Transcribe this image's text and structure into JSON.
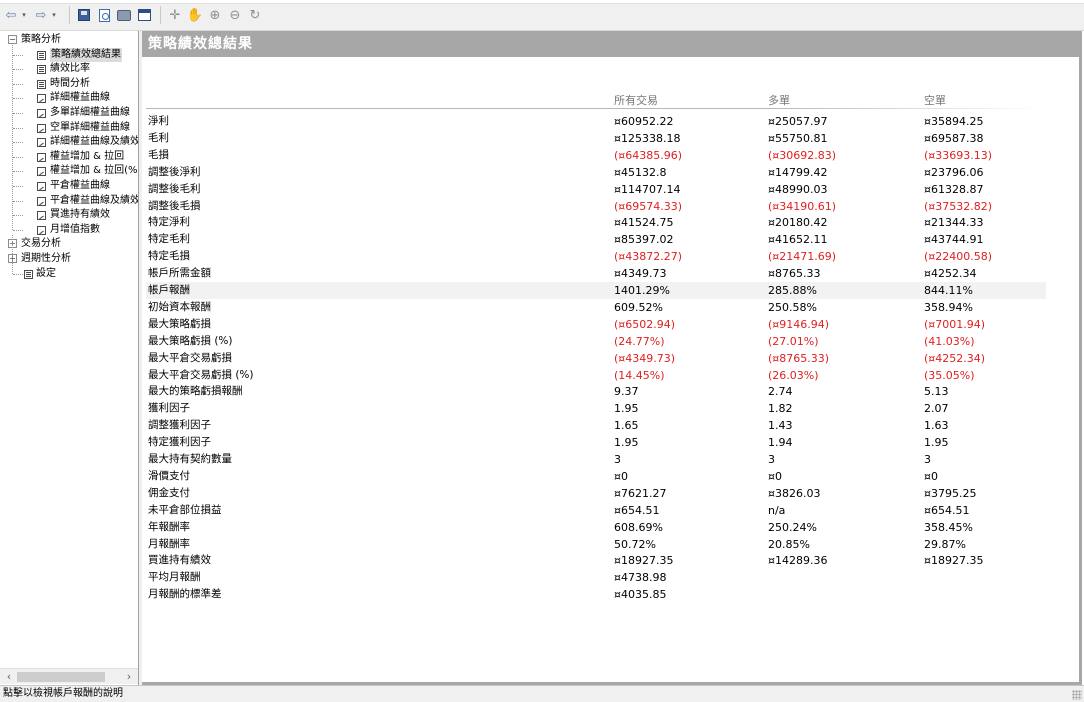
{
  "tree": {
    "root_label": "策略分析",
    "children": [
      {
        "label": "策略績效總結果",
        "icon": "table-icon",
        "selected": true
      },
      {
        "label": "績效比率",
        "icon": "table-icon"
      },
      {
        "label": "時間分析",
        "icon": "table-icon"
      },
      {
        "label": "詳細權益曲線",
        "icon": "chart-icon"
      },
      {
        "label": "多單詳細權益曲線",
        "icon": "chart-icon"
      },
      {
        "label": "空單詳細權益曲線",
        "icon": "chart-icon"
      },
      {
        "label": "詳細權益曲線及績效",
        "icon": "chart-icon"
      },
      {
        "label": "權益增加 & 拉回",
        "icon": "chart-icon"
      },
      {
        "label": "權益增加 & 拉回(%)",
        "icon": "chart-icon"
      },
      {
        "label": "平倉權益曲線",
        "icon": "chart-icon"
      },
      {
        "label": "平倉權益曲線及績效",
        "icon": "chart-icon"
      },
      {
        "label": "買進持有績效",
        "icon": "chart-icon"
      },
      {
        "label": "月增值指數",
        "icon": "chart-icon"
      }
    ],
    "siblings": [
      {
        "label": "交易分析",
        "expander": "+"
      },
      {
        "label": "週期性分析",
        "expander": "+"
      },
      {
        "label": "設定",
        "icon": "table-icon"
      }
    ]
  },
  "main": {
    "title": "策略績效總結果",
    "columns": [
      "所有交易",
      "多單",
      "空單"
    ],
    "rows": [
      {
        "label": "淨利",
        "values": [
          "¤60952.22",
          "¤25057.97",
          "¤35894.25"
        ],
        "negative": [
          false,
          false,
          false
        ]
      },
      {
        "label": "毛利",
        "values": [
          "¤125338.18",
          "¤55750.81",
          "¤69587.38"
        ],
        "negative": [
          false,
          false,
          false
        ]
      },
      {
        "label": "毛損",
        "values": [
          "(¤64385.96)",
          "(¤30692.83)",
          "(¤33693.13)"
        ],
        "negative": [
          true,
          true,
          true
        ]
      },
      {
        "label": "調整後淨利",
        "values": [
          "¤45132.8",
          "¤14799.42",
          "¤23796.06"
        ],
        "negative": [
          false,
          false,
          false
        ]
      },
      {
        "label": "調整後毛利",
        "values": [
          "¤114707.14",
          "¤48990.03",
          "¤61328.87"
        ],
        "negative": [
          false,
          false,
          false
        ]
      },
      {
        "label": "調整後毛損",
        "values": [
          "(¤69574.33)",
          "(¤34190.61)",
          "(¤37532.82)"
        ],
        "negative": [
          true,
          true,
          true
        ]
      },
      {
        "label": "特定淨利",
        "values": [
          "¤41524.75",
          "¤20180.42",
          "¤21344.33"
        ],
        "negative": [
          false,
          false,
          false
        ]
      },
      {
        "label": "特定毛利",
        "values": [
          "¤85397.02",
          "¤41652.11",
          "¤43744.91"
        ],
        "negative": [
          false,
          false,
          false
        ]
      },
      {
        "label": "特定毛損",
        "values": [
          "(¤43872.27)",
          "(¤21471.69)",
          "(¤22400.58)"
        ],
        "negative": [
          true,
          true,
          true
        ]
      },
      {
        "label": "帳戶所需金額",
        "values": [
          "¤4349.73",
          "¤8765.33",
          "¤4252.34"
        ],
        "negative": [
          false,
          false,
          false
        ]
      },
      {
        "label": "帳戶報酬",
        "values": [
          "1401.29%",
          "285.88%",
          "844.11%"
        ],
        "negative": [
          false,
          false,
          false
        ],
        "highlight": true
      },
      {
        "label": "初始資本報酬",
        "values": [
          "609.52%",
          "250.58%",
          "358.94%"
        ],
        "negative": [
          false,
          false,
          false
        ]
      },
      {
        "label": "最大策略虧損",
        "values": [
          "(¤6502.94)",
          "(¤9146.94)",
          "(¤7001.94)"
        ],
        "negative": [
          true,
          true,
          true
        ]
      },
      {
        "label": "最大策略虧損 (%)",
        "values": [
          "(24.77%)",
          "(27.01%)",
          "(41.03%)"
        ],
        "negative": [
          true,
          true,
          true
        ]
      },
      {
        "label": "最大平倉交易虧損",
        "values": [
          "(¤4349.73)",
          "(¤8765.33)",
          "(¤4252.34)"
        ],
        "negative": [
          true,
          true,
          true
        ]
      },
      {
        "label": "最大平倉交易虧損 (%)",
        "values": [
          "(14.45%)",
          "(26.03%)",
          "(35.05%)"
        ],
        "negative": [
          true,
          true,
          true
        ]
      },
      {
        "label": "最大的策略虧損報酬",
        "values": [
          "9.37",
          "2.74",
          "5.13"
        ],
        "negative": [
          false,
          false,
          false
        ]
      },
      {
        "label": "獲利因子",
        "values": [
          "1.95",
          "1.82",
          "2.07"
        ],
        "negative": [
          false,
          false,
          false
        ]
      },
      {
        "label": "調整獲利因子",
        "values": [
          "1.65",
          "1.43",
          "1.63"
        ],
        "negative": [
          false,
          false,
          false
        ]
      },
      {
        "label": "特定獲利因子",
        "values": [
          "1.95",
          "1.94",
          "1.95"
        ],
        "negative": [
          false,
          false,
          false
        ]
      },
      {
        "label": "最大持有契約數量",
        "values": [
          "3",
          "3",
          "3"
        ],
        "negative": [
          false,
          false,
          false
        ]
      },
      {
        "label": "滑價支付",
        "values": [
          "¤0",
          "¤0",
          "¤0"
        ],
        "negative": [
          false,
          false,
          false
        ]
      },
      {
        "label": "佣金支付",
        "values": [
          "¤7621.27",
          "¤3826.03",
          "¤3795.25"
        ],
        "negative": [
          false,
          false,
          false
        ]
      },
      {
        "label": "未平倉部位損益",
        "values": [
          "¤654.51",
          "n/a",
          "¤654.51"
        ],
        "negative": [
          false,
          false,
          false
        ]
      },
      {
        "label": "年報酬率",
        "values": [
          "608.69%",
          "250.24%",
          "358.45%"
        ],
        "negative": [
          false,
          false,
          false
        ]
      },
      {
        "label": "月報酬率",
        "values": [
          "50.72%",
          "20.85%",
          "29.87%"
        ],
        "negative": [
          false,
          false,
          false
        ]
      },
      {
        "label": "買進持有績效",
        "values": [
          "¤18927.35",
          "¤14289.36",
          "¤18927.35"
        ],
        "negative": [
          false,
          false,
          false
        ]
      },
      {
        "label": "平均月報酬",
        "values": [
          "¤4738.98",
          "",
          ""
        ],
        "negative": [
          false,
          false,
          false
        ]
      },
      {
        "label": "月報酬的標準差",
        "values": [
          "¤4035.85",
          "",
          ""
        ],
        "negative": [
          false,
          false,
          false
        ]
      }
    ]
  },
  "statusbar": {
    "text": "點擊以檢視帳戶報酬的說明"
  },
  "colors": {
    "negative": "#e02020",
    "title_bar": "#a7a7a7",
    "header_text": "#777777"
  }
}
